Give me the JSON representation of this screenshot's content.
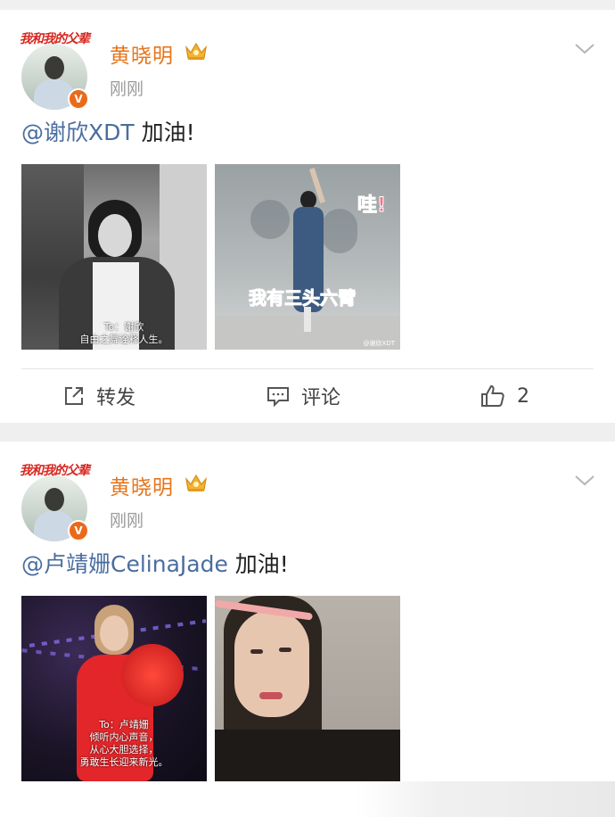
{
  "posts": [
    {
      "avatar_logo": "我和我的父辈",
      "username": "黄晓明",
      "time": "刚刚",
      "mention": "@谢欣XDT",
      "text": " 加油!",
      "image1": {
        "caption_line1": "To：谢欣",
        "caption_line2": "自由之舞诠释人生。"
      },
      "image2": {
        "bubble": "哇!",
        "overlay": "我有三头六臂",
        "watermark": "@谢欣XDT"
      },
      "actions": {
        "repost": "转发",
        "comment": "评论",
        "like_count": "2"
      }
    },
    {
      "avatar_logo": "我和我的父辈",
      "username": "黄晓明",
      "time": "刚刚",
      "mention": "@卢靖姗CelinaJade",
      "text": " 加油!",
      "image1": {
        "caption_line1": "To：卢靖姗",
        "caption_line2": "倾听内心声音，",
        "caption_line3": "从心大胆选择，",
        "caption_line4": "勇敢生长迎来新光。"
      }
    }
  ],
  "icons": {
    "verified": "v-badge-icon",
    "crown": "crown-icon",
    "more": "chevron-down-icon",
    "repost": "repost-icon",
    "comment": "comment-icon",
    "like": "thumbs-up-icon"
  },
  "colors": {
    "username": "#e8751a",
    "mention": "#4a6da0",
    "verified": "#ea6a1a"
  }
}
